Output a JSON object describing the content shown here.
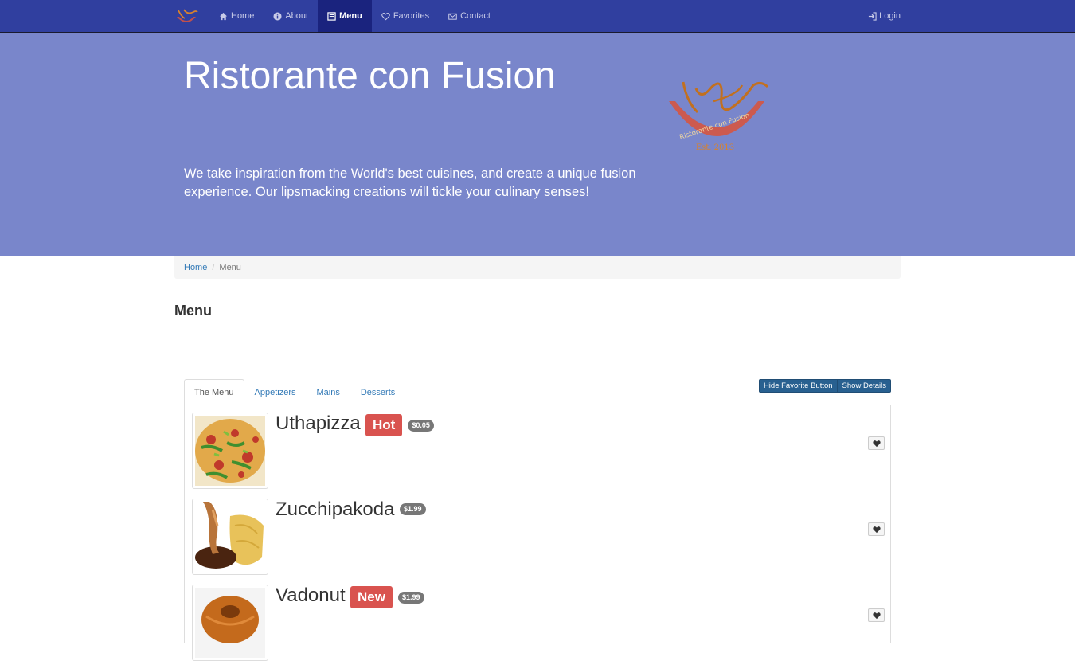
{
  "navbar": {
    "items": [
      {
        "label": "Home",
        "icon": "home-icon"
      },
      {
        "label": "About",
        "icon": "info-circle-icon"
      },
      {
        "label": "Menu",
        "icon": "list-alt-icon",
        "active": true
      },
      {
        "label": "Favorites",
        "icon": "heart-outline-icon"
      },
      {
        "label": "Contact",
        "icon": "envelope-icon"
      }
    ],
    "login_label": "Login",
    "bg_color": "#303F9F",
    "active_color": "#1A237E"
  },
  "jumbotron": {
    "title": "Ristorante con Fusion",
    "description": "We take inspiration from the World's best cuisines, and create a unique fusion experience. Our lipsmacking creations will tickle your culinary senses!",
    "bg_color": "#7986CB",
    "logo_text": "Ristorante con Fusion",
    "logo_est": "Est. 2013"
  },
  "breadcrumb": {
    "home": "Home",
    "current": "Menu"
  },
  "page": {
    "title": "Menu"
  },
  "tabs": {
    "items": [
      "The Menu",
      "Appetizers",
      "Mains",
      "Desserts"
    ],
    "active": "The Menu",
    "hide_favorite_label": "Hide Favorite Button",
    "show_details_label": "Show Details"
  },
  "dishes": [
    {
      "name": "Uthapizza",
      "label": "Hot",
      "price": "$0.05"
    },
    {
      "name": "Zucchipakoda",
      "label": "",
      "price": "$1.99"
    },
    {
      "name": "Vadonut",
      "label": "New",
      "price": "$1.99"
    }
  ]
}
